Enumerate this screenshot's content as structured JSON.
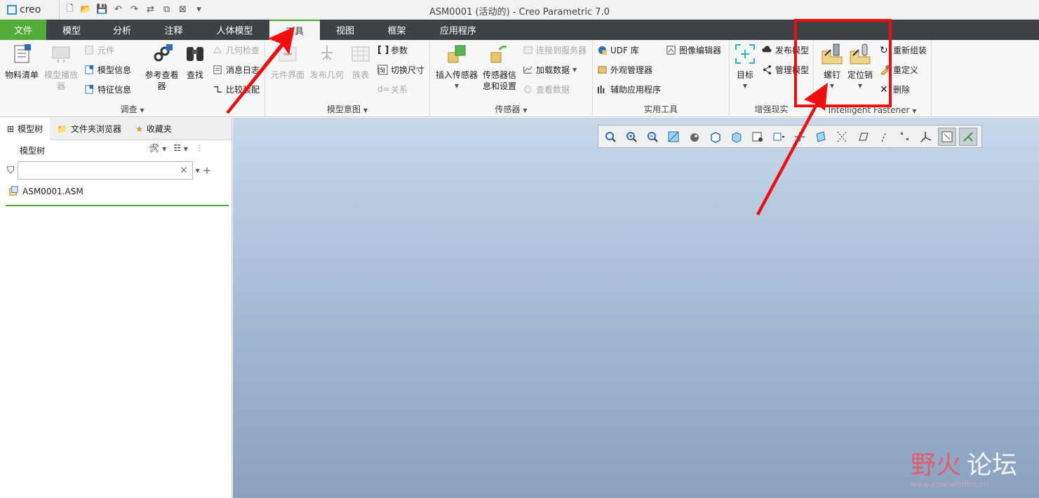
{
  "app": {
    "logo_text": "creo",
    "window_title": "ASM0001 (活动的) - Creo Parametric 7.0"
  },
  "tabs": [
    "文件",
    "模型",
    "分析",
    "注释",
    "人体模型",
    "工具",
    "视图",
    "框架",
    "应用程序"
  ],
  "ribbon": {
    "investigate": {
      "label": "调查",
      "bom": "物料清单",
      "model_player": "模型播放器",
      "component": "元件",
      "model_info": "模型信息",
      "feature_info": "特征信息",
      "ref_viewer": "参考查看器",
      "find": "查找",
      "geom_check": "几何检查",
      "message_log": "消息日志",
      "compare_assy": "比较装配"
    },
    "model_intent": {
      "label": "模型意图",
      "component_interface": "元件界面",
      "publish_geom": "发布几何",
      "family_table": "族表",
      "params": "参数",
      "switch_dims": "切换尺寸",
      "relations": "关系"
    },
    "sensors": {
      "label": "传感器",
      "insert_sensor": "插入传感器",
      "sensor_info": "传感器信息和设置",
      "connect_server": "连接到服务器",
      "load_data": "加载数据",
      "view_data": "查看数据"
    },
    "utilities": {
      "label": "实用工具",
      "udf": "UDF 库",
      "appearance": "外观管理器",
      "aux_apps": "辅助应用程序",
      "image_editor": "图像编辑器"
    },
    "ar": {
      "label": "增强现实",
      "target": "目标",
      "publish_model": "发布模型",
      "manage_model": "管理模型"
    },
    "fastener": {
      "label": "Intelligent Fastener",
      "screw": "螺钉",
      "pin": "定位销",
      "reassemble": "重新组装",
      "redefine": "重定义",
      "delete": "删除"
    }
  },
  "panel": {
    "tabs": [
      "模型树",
      "文件夹浏览器",
      "收藏夹"
    ],
    "title": "模型树",
    "search_placeholder": "",
    "tree": [
      {
        "label": "ASM0001.ASM"
      }
    ]
  },
  "watermark": {
    "text1": "野火",
    "text2": "论坛",
    "sub": "www.proewildfire.cn"
  },
  "colors": {
    "accent": "#52ad38",
    "annotation": "#f20d0d"
  }
}
